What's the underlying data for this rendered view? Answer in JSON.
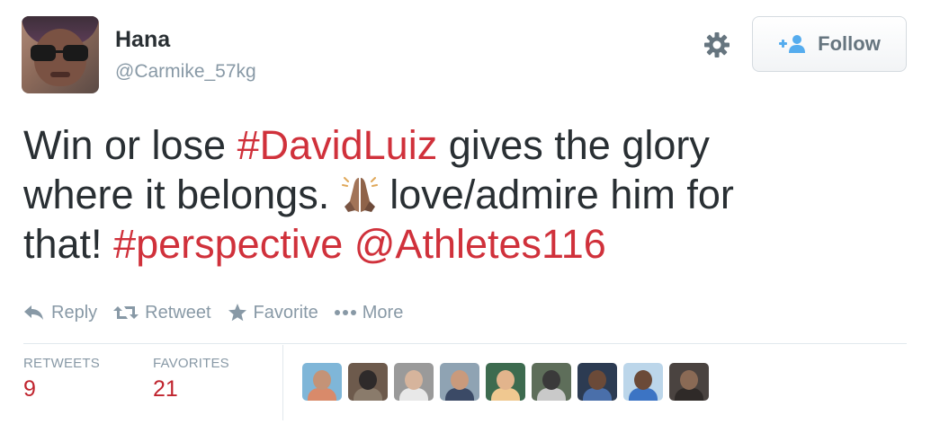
{
  "user": {
    "name": "Hana",
    "handle": "@Carmike_57kg",
    "avatar_icon": "user-avatar"
  },
  "header": {
    "settings_icon": "gear-icon",
    "follow_label": "Follow",
    "follow_icon": "add-user-icon"
  },
  "tweet": {
    "line1_pre": "Win or lose ",
    "line1_hashtag": "#DavidLuiz",
    "line1_post": " gives the glory",
    "line2_pre": "where it belongs. ",
    "line2_emoji": "folded-hands-emoji",
    "line2_post": " love/admire him for",
    "line3_pre": "that! ",
    "line3_hashtag": "#perspective",
    "line3_mid": " ",
    "line3_mention": "@Athletes116"
  },
  "actions": {
    "reply": "Reply",
    "retweet": "Retweet",
    "favorite": "Favorite",
    "more": "More"
  },
  "stats": {
    "retweets_label": "RETWEETS",
    "retweets_value": "9",
    "favorites_label": "FAVORITES",
    "favorites_value": "21"
  },
  "favoriters": [
    {
      "name": "favoriter-1",
      "bg": "#7fb6d8",
      "head": "#c49377",
      "body": "#d98a6a"
    },
    {
      "name": "favoriter-2",
      "bg": "#6d5a4c",
      "head": "#2e2a2a",
      "body": "#8a7b6b"
    },
    {
      "name": "favoriter-3",
      "bg": "#9a9a9a",
      "head": "#d6b49c",
      "body": "#e8e8e8"
    },
    {
      "name": "favoriter-4",
      "bg": "#8fa3b3",
      "head": "#c99a7c",
      "body": "#3b4a66"
    },
    {
      "name": "favoriter-5",
      "bg": "#3d6b4f",
      "head": "#e2b48c",
      "body": "#f0c890"
    },
    {
      "name": "favoriter-6",
      "bg": "#5e6e5a",
      "head": "#3a3a3a",
      "body": "#c9c9c9"
    },
    {
      "name": "favoriter-7",
      "bg": "#2c3b52",
      "head": "#6b4a38",
      "body": "#4a6faa"
    },
    {
      "name": "favoriter-8",
      "bg": "#bcd6ea",
      "head": "#6b4a38",
      "body": "#3c74c4"
    },
    {
      "name": "favoriter-9",
      "bg": "#4a4340",
      "head": "#8a6a55",
      "body": "#2f2a28"
    }
  ],
  "colors": {
    "link": "#d0313b",
    "count": "#c0242e",
    "muted": "#8899a6",
    "text": "#292f33"
  }
}
